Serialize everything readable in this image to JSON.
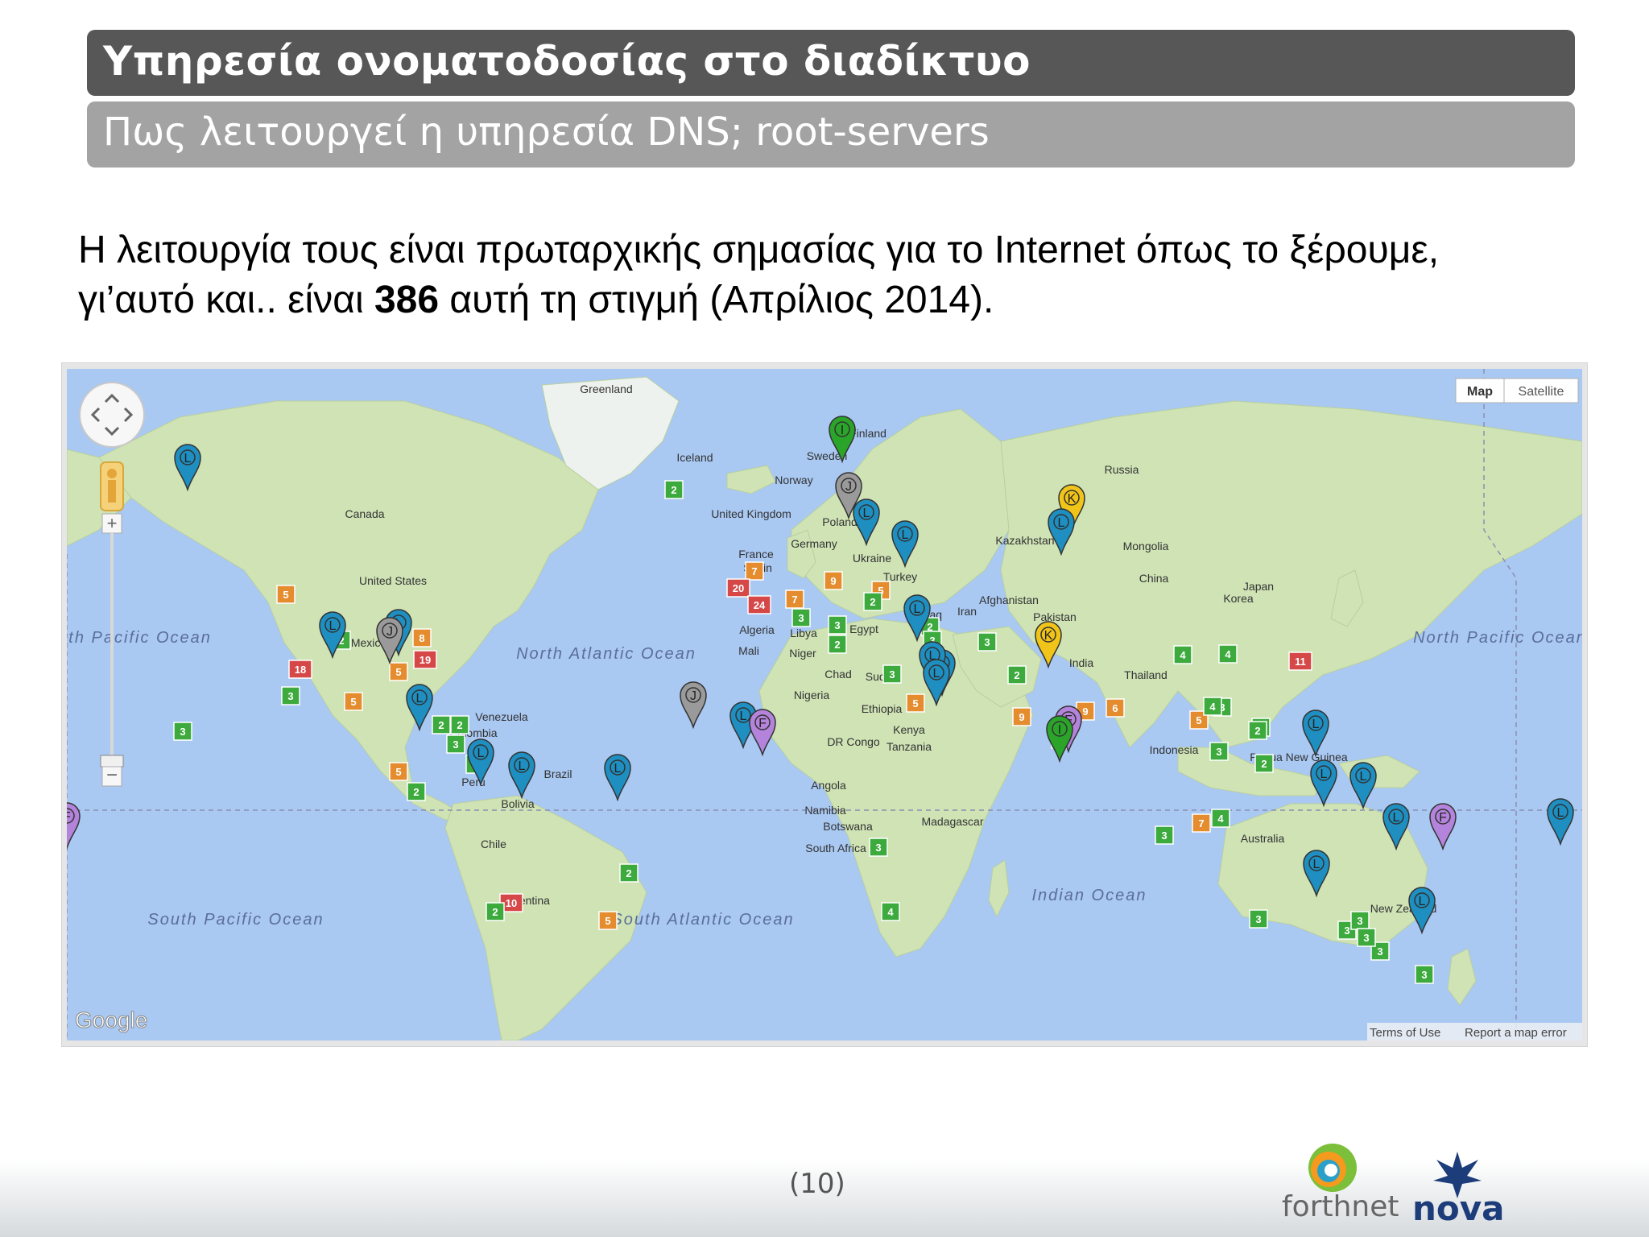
{
  "slide": {
    "title": "Υπηρεσία ονοματοδοσίας στο διαδίκτυο",
    "subtitle": "Πως λειτουργεί η υπηρεσία DNS; root-servers",
    "body_line1": "Η λειτουργία τους είναι πρωταρχικής σημασίας για το Internet όπως το ξέρουμε,",
    "body_line2_prefix": "γι’αυτό και.. είναι ",
    "body_line2_bold": "386",
    "body_line2_suffix": " αυτή τη στιγμή (Απρίλιος 2014).",
    "page_number": "(10)"
  },
  "map": {
    "type_buttons": [
      "Map",
      "Satellite"
    ],
    "attribution": "Google",
    "terms": "Terms of Use",
    "report": "Report a map error",
    "ocean_labels": [
      "North Pacific Ocean",
      "North Atlantic Ocean",
      "South Pacific Ocean",
      "South Atlantic Ocean",
      "Indian Ocean",
      "North Pacific Ocean"
    ],
    "place_labels": [
      "Greenland",
      "Canada",
      "United States",
      "Mexico",
      "Venezuela",
      "Colombia",
      "Peru",
      "Brazil",
      "Bolivia",
      "Chile",
      "Argentina",
      "Iceland",
      "Sweden",
      "Finland",
      "Norway",
      "United Kingdom",
      "Poland",
      "Germany",
      "France",
      "Spain",
      "Ukraine",
      "Turkey",
      "Russia",
      "Kazakhstan",
      "Mongolia",
      "China",
      "Japan",
      "Korea",
      "Iran",
      "Iraq",
      "Afghanistan",
      "Pakistan",
      "India",
      "Thailand",
      "Algeria",
      "Libya",
      "Egypt",
      "Mali",
      "Niger",
      "Chad",
      "Sudan",
      "Nigeria",
      "Ethiopia",
      "Kenya",
      "DR Congo",
      "Tanzania",
      "Angola",
      "Namibia",
      "Botswana",
      "South Africa",
      "Madagascar",
      "Indonesia",
      "Papua New Guinea",
      "Australia",
      "New Zealand"
    ],
    "pin_colors": {
      "L": "#1e8fc0",
      "I": "#2aa52a",
      "J": "#9a9a9a",
      "K": "#f0c419",
      "F": "#b483db"
    },
    "cluster_colors": {
      "small": "#3caa3c",
      "medium": "#e48c2e",
      "large": "#d64747"
    },
    "clusters": [
      "2",
      "5",
      "2",
      "7",
      "8",
      "19",
      "18",
      "3",
      "5",
      "5",
      "3",
      "2",
      "2",
      "3",
      "2",
      "5",
      "2",
      "10",
      "2",
      "2",
      "5",
      "4",
      "3",
      "7",
      "20",
      "9",
      "24",
      "7",
      "5",
      "2",
      "3",
      "3",
      "2",
      "2",
      "9",
      "3",
      "3",
      "5",
      "3",
      "2",
      "2",
      "9",
      "2",
      "6",
      "4",
      "4",
      "2",
      "4",
      "11",
      "3",
      "5",
      "3",
      "3",
      "7",
      "3",
      "3",
      "3",
      "3",
      "3",
      "3",
      "4",
      "3",
      "2"
    ],
    "pin_letters": [
      "L",
      "L",
      "L",
      "J",
      "L",
      "L",
      "L",
      "L",
      "I",
      "J",
      "L",
      "L",
      "K",
      "L",
      "K",
      "L",
      "L",
      "L",
      "L",
      "J",
      "L",
      "F",
      "F",
      "I",
      "L",
      "L",
      "L",
      "L",
      "L",
      "L",
      "F",
      "L",
      "F"
    ]
  }
}
